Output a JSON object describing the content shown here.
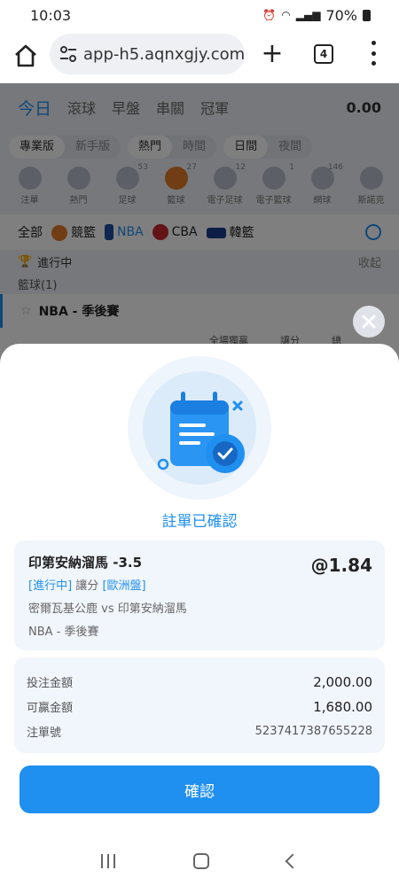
{
  "status_bar": {
    "time": "10:03",
    "battery": "70%"
  },
  "browser": {
    "url": "app-h5.aqnxgjy.com",
    "tab_count": "4"
  },
  "app": {
    "tabs": [
      "今日",
      "滾球",
      "早盤",
      "串關",
      "冠軍"
    ],
    "balance": "0.00",
    "version_toggle": [
      "專業版",
      "新手版"
    ],
    "sort_toggle": [
      "熱門",
      "時間"
    ],
    "theme_toggle": [
      "日間",
      "夜間"
    ],
    "sports": [
      {
        "label": "注單",
        "count": ""
      },
      {
        "label": "熱門",
        "count": ""
      },
      {
        "label": "足球",
        "count": "53"
      },
      {
        "label": "籃球",
        "count": "27"
      },
      {
        "label": "電子足球",
        "count": "12"
      },
      {
        "label": "電子籃球",
        "count": "1"
      },
      {
        "label": "網球",
        "count": "146"
      },
      {
        "label": "斯諾克",
        "count": ""
      }
    ],
    "leagues": [
      "全部",
      "競籃",
      "NBA",
      "CBA",
      "韓籃"
    ],
    "live_label": "進行中",
    "collapse_label": "收起",
    "category": "籃球(1)",
    "match_league": "NBA - 季後賽",
    "odds_headers": [
      "全場獨贏",
      "讓分",
      "總"
    ]
  },
  "sheet": {
    "title": "註單已確認",
    "bet": {
      "selection": "印第安納溜馬 -3.5",
      "odds": "@1.84",
      "status": "[進行中]",
      "market": "讓分",
      "odds_type": "[歐洲盤]",
      "teams": "密爾瓦基公鹿 vs 印第安納溜馬",
      "league": "NBA - 季後賽"
    },
    "summary": {
      "stake_label": "投注金額",
      "stake_value": "2,000.00",
      "win_label": "可贏金額",
      "win_value": "1,680.00",
      "ticket_label": "注單號",
      "ticket_value": "5237417387655228"
    },
    "confirm_label": "確認"
  },
  "colors": {
    "accent": "#1f8ff0",
    "card_bg": "#f1f6fc"
  }
}
